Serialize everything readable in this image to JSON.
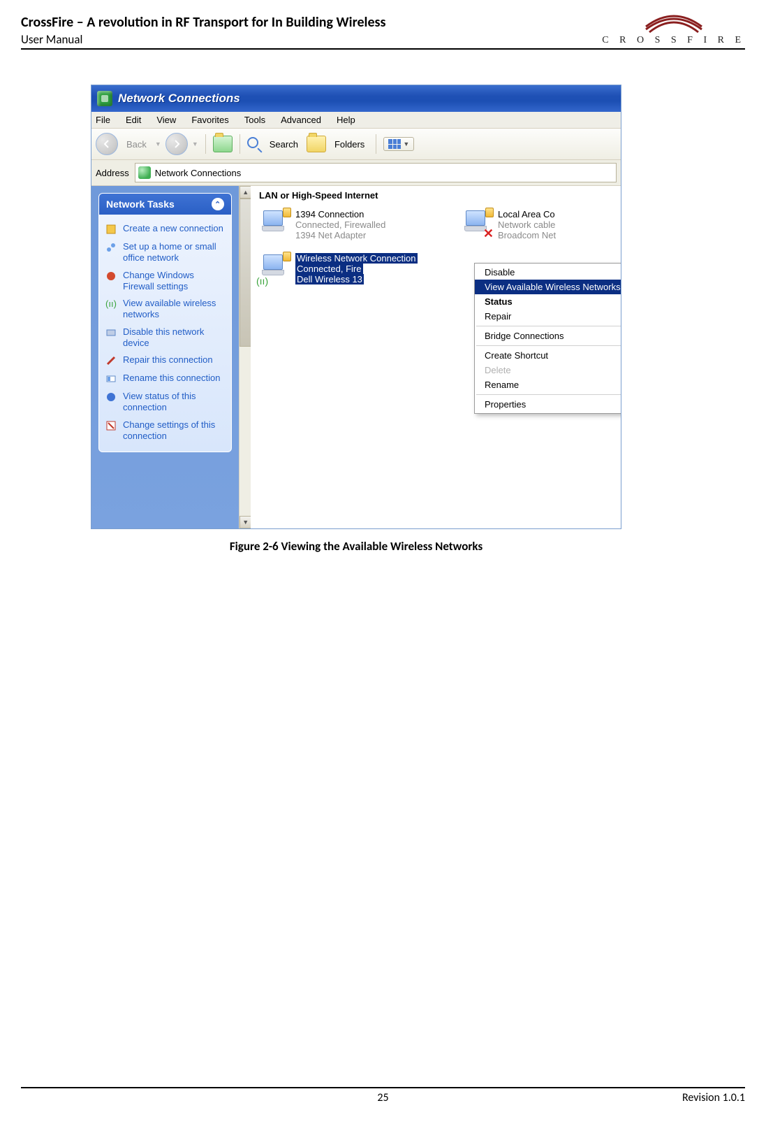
{
  "doc": {
    "title": "CrossFire – A revolution in RF Transport for In Building Wireless",
    "subtitle": "User Manual",
    "brand": "C R O S S F I R E",
    "page_number": "25",
    "revision": "Revision 1.0.1",
    "figure_caption": "Figure 2-6 Viewing the Available Wireless Networks"
  },
  "window": {
    "title": "Network Connections",
    "menubar": [
      "File",
      "Edit",
      "View",
      "Favorites",
      "Tools",
      "Advanced",
      "Help"
    ],
    "toolbar": {
      "back": "Back",
      "search": "Search",
      "folders": "Folders"
    },
    "address_label": "Address",
    "address_value": "Network Connections",
    "sidebar": {
      "panel_title": "Network Tasks",
      "items": [
        {
          "icon": "new-connection-icon",
          "label": "Create a new connection"
        },
        {
          "icon": "small-network-icon",
          "label": "Set up a home or small office network"
        },
        {
          "icon": "firewall-icon",
          "label": "Change Windows Firewall settings"
        },
        {
          "icon": "wireless-signal-icon",
          "label": "View available wireless networks"
        },
        {
          "icon": "disable-device-icon",
          "label": "Disable this network device"
        },
        {
          "icon": "repair-icon",
          "label": "Repair this connection"
        },
        {
          "icon": "rename-icon",
          "label": "Rename this connection"
        },
        {
          "icon": "status-icon",
          "label": "View status of this connection"
        },
        {
          "icon": "settings-icon",
          "label": "Change settings of this connection"
        }
      ]
    },
    "content": {
      "section_header": "LAN or High-Speed Internet",
      "connections": [
        {
          "name": "1394 Connection",
          "status": "Connected, Firewalled",
          "device": "1394 Net Adapter",
          "type": "firewire"
        },
        {
          "name": "Local Area Co",
          "status": "Network cable",
          "device": "Broadcom Net",
          "type": "lan-disconnected"
        },
        {
          "name": "Wireless Network Connection",
          "status": "Connected, Fire",
          "device": "Dell Wireless 13",
          "type": "wireless",
          "selected": true
        }
      ]
    },
    "context_menu": {
      "items": [
        {
          "label": "Disable",
          "state": "normal"
        },
        {
          "label": "View Available Wireless Networks",
          "state": "selected"
        },
        {
          "label": "Status",
          "state": "bold"
        },
        {
          "label": "Repair",
          "state": "normal"
        },
        {
          "sep": true
        },
        {
          "label": "Bridge Connections",
          "state": "normal"
        },
        {
          "sep": true
        },
        {
          "label": "Create Shortcut",
          "state": "normal"
        },
        {
          "label": "Delete",
          "state": "disabled"
        },
        {
          "label": "Rename",
          "state": "normal"
        },
        {
          "sep": true
        },
        {
          "label": "Properties",
          "state": "normal"
        }
      ]
    }
  }
}
